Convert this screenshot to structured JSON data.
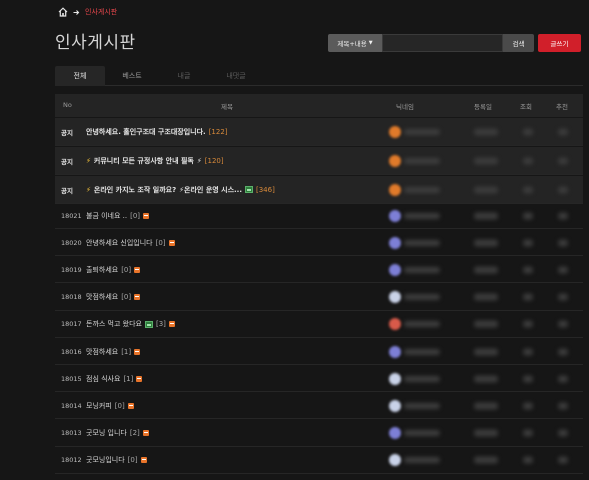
{
  "breadcrumb": {
    "home_icon": "home-icon",
    "arrow_icon": "arrow-right-icon",
    "current": "인사게시판"
  },
  "page_title": "인사게시판",
  "search": {
    "filter_label": "제목+내용",
    "placeholder": "",
    "button_label": "검색"
  },
  "write_button": "글쓰기",
  "tabs": [
    {
      "label": "전체",
      "active": true
    },
    {
      "label": "베스트",
      "active": false
    },
    {
      "label": "내글",
      "active": false
    },
    {
      "label": "내댓글",
      "active": false
    }
  ],
  "table_headers": {
    "no": "No",
    "subject": "제목",
    "nickname": "닉네임",
    "date": "등록일",
    "views": "조회",
    "recommend": "추천"
  },
  "notices": [
    {
      "no": "공지",
      "prefix": "",
      "title": "안녕하세요. 홀인구조대 구조대장입니다.",
      "suffix": "",
      "comments": "[122]",
      "has_image": false,
      "avatar_color": "#e07a2a"
    },
    {
      "no": "공지",
      "prefix": "⚡",
      "title": "커뮤니티 모든 규정사항 안내 필독",
      "suffix": "⚡",
      "comments": "[120]",
      "has_image": false,
      "avatar_color": "#e07a2a"
    },
    {
      "no": "공지",
      "prefix": "⚡",
      "title": "온라인 카지노 조작 일까요?",
      "suffix": "⚡온라인 운영 시스...",
      "comments": "[346]",
      "has_image": true,
      "avatar_color": "#e07a2a"
    }
  ],
  "posts": [
    {
      "no": "18021",
      "title": "불금 이네요 ..",
      "comments": "[0]",
      "has_image": false,
      "avatar_color": "#7d7fd6"
    },
    {
      "no": "18020",
      "title": "안녕하세요 신입입니다",
      "comments": "[0]",
      "has_image": false,
      "avatar_color": "#7d7fd6"
    },
    {
      "no": "18019",
      "title": "출퇴하세요",
      "comments": "[0]",
      "has_image": false,
      "avatar_color": "#7d7fd6"
    },
    {
      "no": "18018",
      "title": "맛점하세요",
      "comments": "[0]",
      "has_image": false,
      "avatar_color": "#c9d2e8"
    },
    {
      "no": "18017",
      "title": "돈까스 먹고 왔다요",
      "comments": "[3]",
      "has_image": true,
      "avatar_color": "#d85a4a"
    },
    {
      "no": "18016",
      "title": "맛점하세요",
      "comments": "[1]",
      "has_image": false,
      "avatar_color": "#7d7fd6"
    },
    {
      "no": "18015",
      "title": "점심 식사요",
      "comments": "[1]",
      "has_image": false,
      "avatar_color": "#c9d2e8"
    },
    {
      "no": "18014",
      "title": "모닝커피",
      "comments": "[0]",
      "has_image": false,
      "avatar_color": "#c9d2e8"
    },
    {
      "no": "18013",
      "title": "굿모닝 입니다",
      "comments": "[2]",
      "has_image": false,
      "avatar_color": "#7d7fd6"
    },
    {
      "no": "18012",
      "title": "굿모닝입니다",
      "comments": "[0]",
      "has_image": false,
      "avatar_color": "#c9d2e8"
    }
  ],
  "colors": {
    "accent": "#d11f2a",
    "background": "#161616",
    "notice_bg": "#242424",
    "comment_notice": "#d88a3a"
  }
}
